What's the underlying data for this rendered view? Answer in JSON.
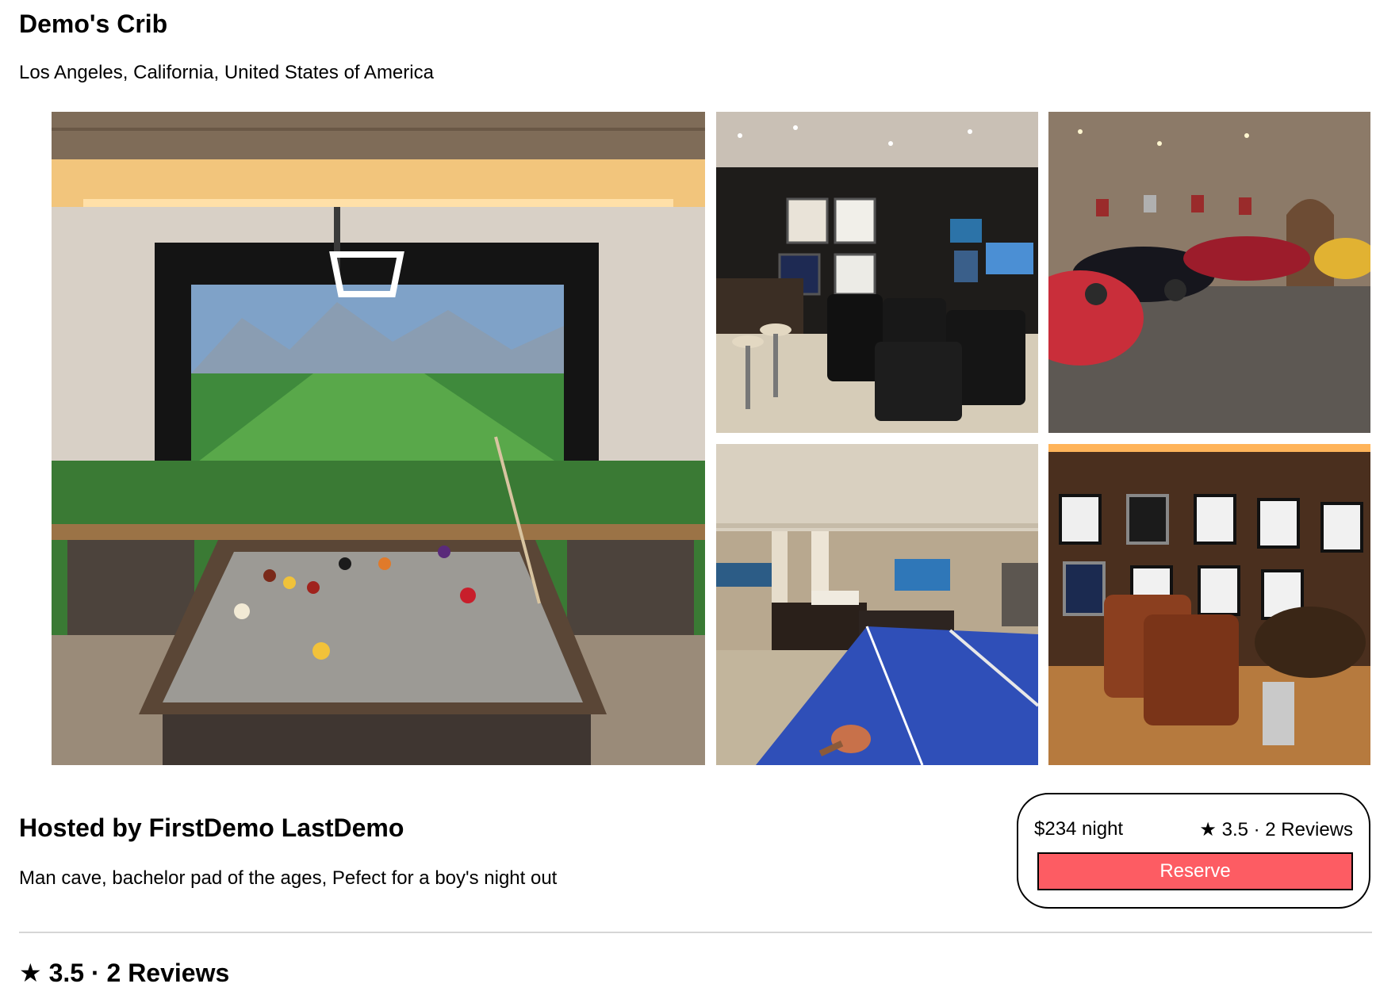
{
  "listing": {
    "title": "Demo's Crib",
    "location": "Los Angeles, California, United States of America"
  },
  "gallery": {
    "photos": [
      {
        "subject": "golf-simulator-billiards-room"
      },
      {
        "subject": "sports-bar-theater-room"
      },
      {
        "subject": "classic-car-garage"
      },
      {
        "subject": "ping-pong-basement"
      },
      {
        "subject": "jersey-theater-room"
      }
    ]
  },
  "host": {
    "title": "Hosted by FirstDemo LastDemo",
    "description": "Man cave, bachelor pad of the ages, Pefect for a boy's night out"
  },
  "booking": {
    "price": "$234 night",
    "star_icon": "★",
    "rating_text": "3.5 · 2 Reviews",
    "reserve_label": "Reserve",
    "reserve_color": "#fd5c63"
  },
  "reviews": {
    "star_icon": "★",
    "heading": "3.5 · 2 Reviews"
  }
}
